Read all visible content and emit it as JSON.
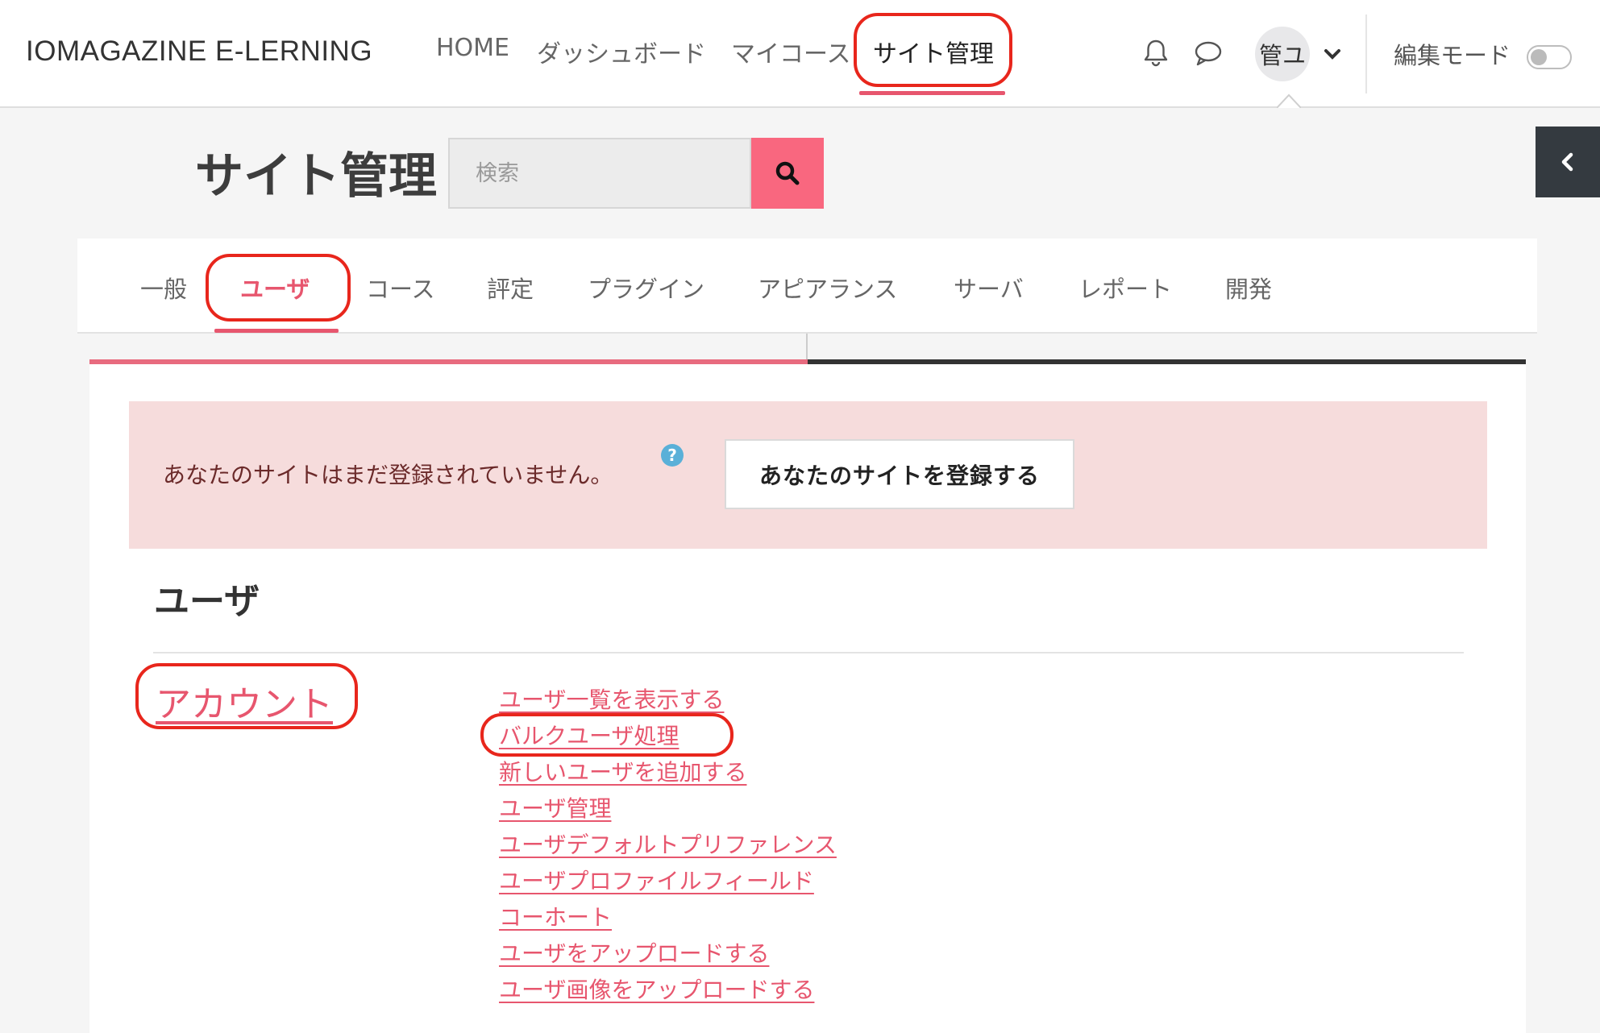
{
  "navbar": {
    "brand": "IOMAGAZINE E-LERNING",
    "items": [
      {
        "label": "HOME"
      },
      {
        "label": "ダッシュボード"
      },
      {
        "label": "マイコース"
      },
      {
        "label": "サイト管理"
      }
    ],
    "avatar_text": "管ユ",
    "edit_mode_label": "編集モード"
  },
  "header": {
    "title": "サイト管理",
    "search_placeholder": "検索"
  },
  "tabs": [
    {
      "label": "一般"
    },
    {
      "label": "ユーザ"
    },
    {
      "label": "コース"
    },
    {
      "label": "評定"
    },
    {
      "label": "プラグイン"
    },
    {
      "label": "アピアランス"
    },
    {
      "label": "サーバ"
    },
    {
      "label": "レポート"
    },
    {
      "label": "開発"
    }
  ],
  "alert": {
    "message": "あなたのサイトはまだ登録されていません。",
    "help_symbol": "?",
    "button_label": "あなたのサイトを登録する"
  },
  "section": {
    "title": "ユーザ",
    "category": "アカウント",
    "links": [
      "ユーザ一覧を表示する",
      "バルクユーザ処理",
      "新しいユーザを追加する",
      "ユーザ管理",
      "ユーザデフォルトプリファレンス",
      "ユーザプロファイルフィールド",
      "コーホート",
      "ユーザをアップロードする",
      "ユーザ画像をアップロードする"
    ]
  },
  "colors": {
    "accent": "#e7566e",
    "annotation": "#e8261c",
    "alert_bg": "#f6dcdc",
    "drawer": "#343a40"
  }
}
